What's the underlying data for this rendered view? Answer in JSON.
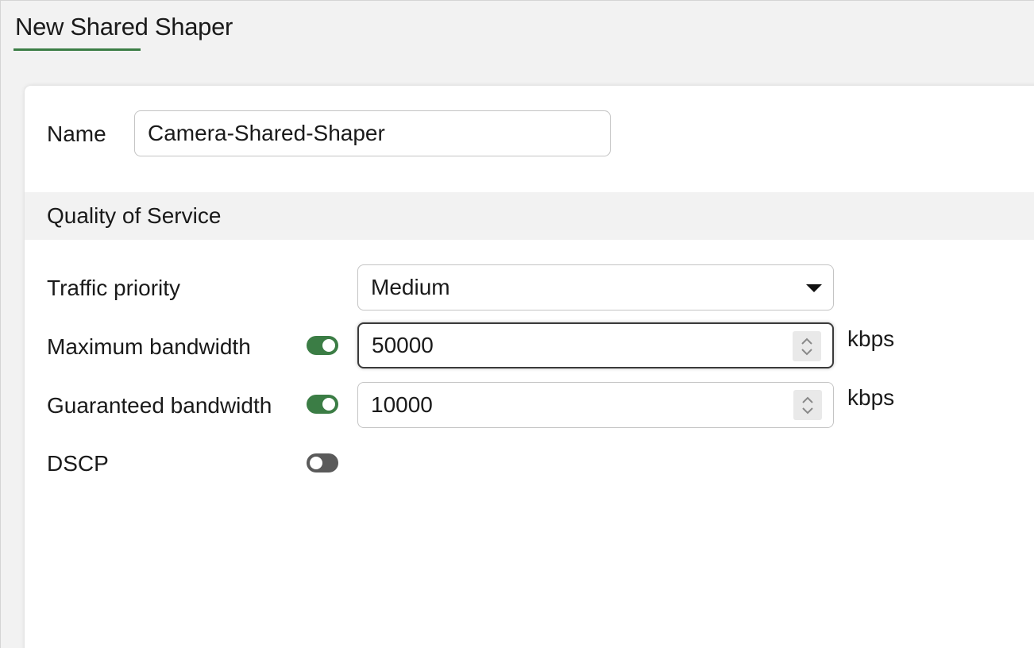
{
  "header": {
    "title": "New Shared Shaper"
  },
  "form": {
    "name_label": "Name",
    "name_value": "Camera-Shared-Shaper",
    "section_title": "Quality of Service",
    "traffic_priority": {
      "label": "Traffic priority",
      "selected": "Medium"
    },
    "maximum_bandwidth": {
      "label": "Maximum bandwidth",
      "enabled": true,
      "value": "50000",
      "unit": "kbps"
    },
    "guaranteed_bandwidth": {
      "label": "Guaranteed bandwidth",
      "enabled": true,
      "value": "10000",
      "unit": "kbps"
    },
    "dscp": {
      "label": "DSCP",
      "enabled": false
    }
  },
  "colors": {
    "accent": "#3b7d45",
    "toggle_off": "#5a5a5a"
  },
  "icons": {
    "dropdown": "caret-down-icon",
    "spinner": "spinner-arrows-icon"
  }
}
